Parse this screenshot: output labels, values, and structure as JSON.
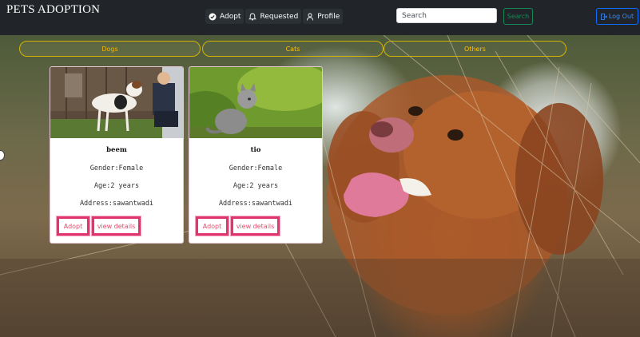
{
  "navbar": {
    "brand": "PETS ADOPTION",
    "links": [
      {
        "label": "Adopt",
        "icon": "check-circle-icon"
      },
      {
        "label": "Requested",
        "icon": "bell-icon"
      },
      {
        "label": "Profile",
        "icon": "user-icon"
      }
    ],
    "search": {
      "placeholder": "Search",
      "value": "",
      "button_label": "Search"
    },
    "logout_label": "Log Out"
  },
  "categories": [
    "Dogs",
    "Cats",
    "Others"
  ],
  "pets": [
    {
      "name": "beem",
      "gender": "Gender:Female",
      "age": "Age:2 years",
      "address": "Address:sawantwadi",
      "adopt_label": "Adopt",
      "details_label": "view details"
    },
    {
      "name": "tio",
      "gender": "Gender:Female",
      "age": "Age:2 years",
      "address": "Address:sawantwadi",
      "adopt_label": "Adopt",
      "details_label": "view details"
    }
  ],
  "colors": {
    "navbar_bg": "#212529",
    "search_button": "#198754",
    "logout_button": "#0d6efd",
    "category_border": "#d4b400",
    "card_button": "#e0356f"
  }
}
